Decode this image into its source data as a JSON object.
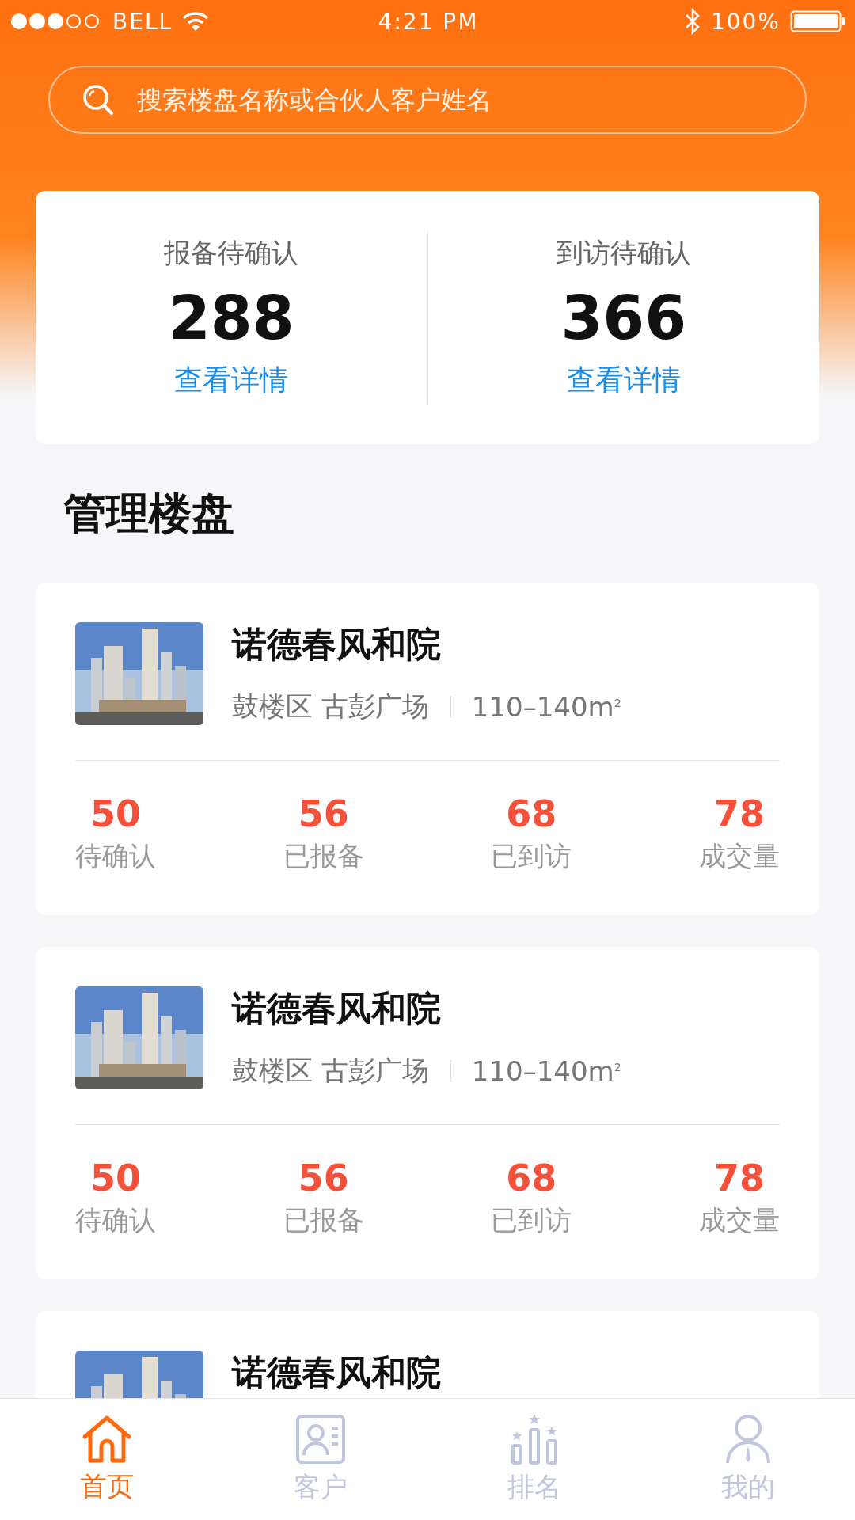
{
  "status_bar": {
    "carrier": "BELL",
    "time": "4:21 PM",
    "battery": "100%"
  },
  "search": {
    "placeholder": "搜索楼盘名称或合伙人客户姓名"
  },
  "summary": [
    {
      "label": "报备待确认",
      "count": "288",
      "link": "查看详情"
    },
    {
      "label": "到访待确认",
      "count": "366",
      "link": "查看详情"
    }
  ],
  "section_title": "管理楼盘",
  "properties": [
    {
      "name": "诺德春风和院",
      "district": "鼓楼区",
      "area": "古彭广场",
      "size": "110–140m",
      "size_sup": "2",
      "stats": [
        {
          "value": "50",
          "label": "待确认"
        },
        {
          "value": "56",
          "label": "已报备"
        },
        {
          "value": "68",
          "label": "已到访"
        },
        {
          "value": "78",
          "label": "成交量"
        }
      ]
    },
    {
      "name": "诺德春风和院",
      "district": "鼓楼区",
      "area": "古彭广场",
      "size": "110–140m",
      "size_sup": "2",
      "stats": [
        {
          "value": "50",
          "label": "待确认"
        },
        {
          "value": "56",
          "label": "已报备"
        },
        {
          "value": "68",
          "label": "已到访"
        },
        {
          "value": "78",
          "label": "成交量"
        }
      ]
    },
    {
      "name": "诺德春风和院"
    }
  ],
  "tabs": [
    {
      "label": "首页",
      "kind": "home",
      "selected": true
    },
    {
      "label": "客户",
      "kind": "contact",
      "selected": false
    },
    {
      "label": "排名",
      "kind": "ranking",
      "selected": false
    },
    {
      "label": "我的",
      "kind": "person",
      "selected": false
    }
  ]
}
